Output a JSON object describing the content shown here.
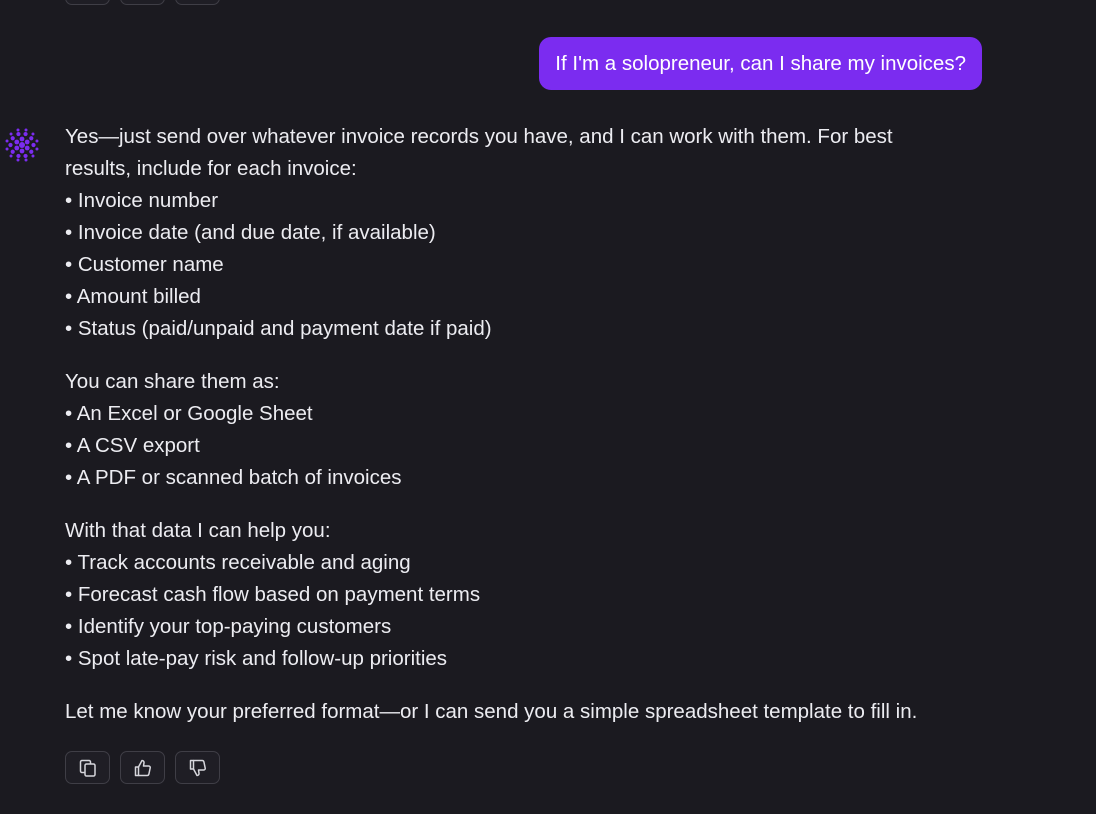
{
  "user_message": {
    "text": "If I'm a solopreneur, can I share my invoices?"
  },
  "assistant_message": {
    "intro": "Yes—just send over whatever invoice records you have, and I can work with them. For best results, include for each invoice:",
    "intro_lines": [
      "Yes—just send over whatever invoice records you have, and I can work with them. For best",
      "results, include for each invoice:"
    ],
    "invoice_fields": [
      "• Invoice number",
      "• Invoice date (and due date, if available)",
      "• Customer name",
      "• Amount billed",
      "• Status (paid/unpaid and payment date if paid)"
    ],
    "share_heading": "You can share them as:",
    "share_formats": [
      "• An Excel or Google Sheet",
      "• A CSV export",
      "• A PDF or scanned batch of invoices"
    ],
    "help_heading": "With that data I can help you:",
    "help_items": [
      "• Track accounts receivable and aging",
      "• Forecast cash flow based on payment terms",
      "• Identify your top-paying customers",
      "• Spot late-pay risk and follow-up priorities"
    ],
    "closing": "Let me know your preferred format—or I can send you a simple spreadsheet template to fill in."
  },
  "actions": [
    {
      "icon": "copy-icon"
    },
    {
      "icon": "thumbs-up-icon"
    },
    {
      "icon": "thumbs-down-icon"
    }
  ],
  "colors": {
    "background": "#1b1a20",
    "user_bubble": "#7b2cf0",
    "avatar": "#7b2cf0",
    "text": "#ececf1"
  }
}
